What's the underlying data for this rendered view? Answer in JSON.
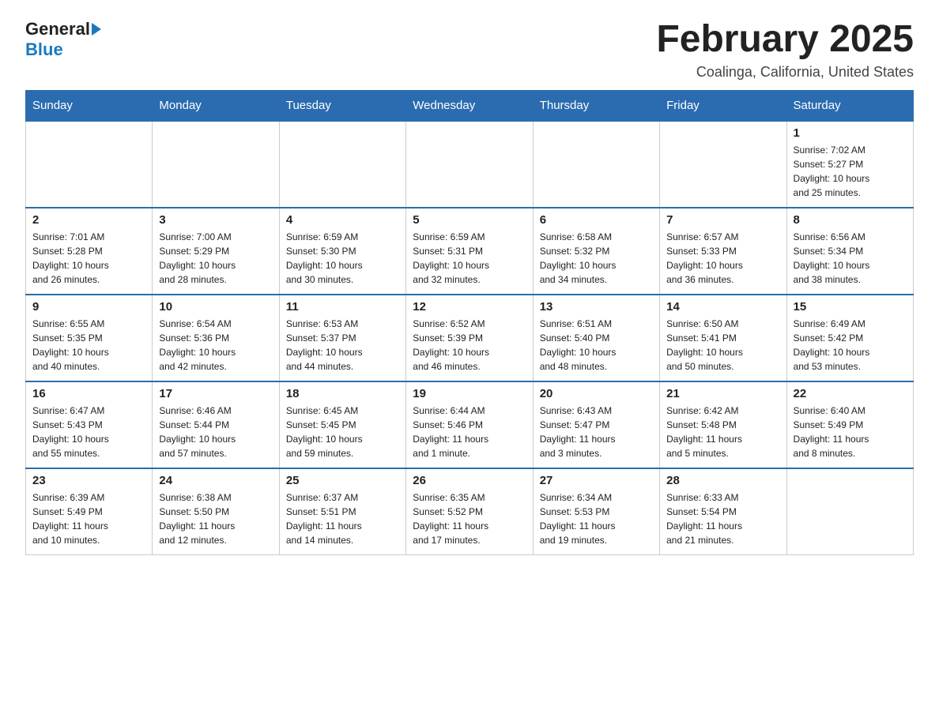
{
  "header": {
    "month_title": "February 2025",
    "location": "Coalinga, California, United States",
    "logo_general": "General",
    "logo_blue": "Blue"
  },
  "weekdays": [
    "Sunday",
    "Monday",
    "Tuesday",
    "Wednesday",
    "Thursday",
    "Friday",
    "Saturday"
  ],
  "weeks": [
    [
      {
        "day": "",
        "info": ""
      },
      {
        "day": "",
        "info": ""
      },
      {
        "day": "",
        "info": ""
      },
      {
        "day": "",
        "info": ""
      },
      {
        "day": "",
        "info": ""
      },
      {
        "day": "",
        "info": ""
      },
      {
        "day": "1",
        "info": "Sunrise: 7:02 AM\nSunset: 5:27 PM\nDaylight: 10 hours\nand 25 minutes."
      }
    ],
    [
      {
        "day": "2",
        "info": "Sunrise: 7:01 AM\nSunset: 5:28 PM\nDaylight: 10 hours\nand 26 minutes."
      },
      {
        "day": "3",
        "info": "Sunrise: 7:00 AM\nSunset: 5:29 PM\nDaylight: 10 hours\nand 28 minutes."
      },
      {
        "day": "4",
        "info": "Sunrise: 6:59 AM\nSunset: 5:30 PM\nDaylight: 10 hours\nand 30 minutes."
      },
      {
        "day": "5",
        "info": "Sunrise: 6:59 AM\nSunset: 5:31 PM\nDaylight: 10 hours\nand 32 minutes."
      },
      {
        "day": "6",
        "info": "Sunrise: 6:58 AM\nSunset: 5:32 PM\nDaylight: 10 hours\nand 34 minutes."
      },
      {
        "day": "7",
        "info": "Sunrise: 6:57 AM\nSunset: 5:33 PM\nDaylight: 10 hours\nand 36 minutes."
      },
      {
        "day": "8",
        "info": "Sunrise: 6:56 AM\nSunset: 5:34 PM\nDaylight: 10 hours\nand 38 minutes."
      }
    ],
    [
      {
        "day": "9",
        "info": "Sunrise: 6:55 AM\nSunset: 5:35 PM\nDaylight: 10 hours\nand 40 minutes."
      },
      {
        "day": "10",
        "info": "Sunrise: 6:54 AM\nSunset: 5:36 PM\nDaylight: 10 hours\nand 42 minutes."
      },
      {
        "day": "11",
        "info": "Sunrise: 6:53 AM\nSunset: 5:37 PM\nDaylight: 10 hours\nand 44 minutes."
      },
      {
        "day": "12",
        "info": "Sunrise: 6:52 AM\nSunset: 5:39 PM\nDaylight: 10 hours\nand 46 minutes."
      },
      {
        "day": "13",
        "info": "Sunrise: 6:51 AM\nSunset: 5:40 PM\nDaylight: 10 hours\nand 48 minutes."
      },
      {
        "day": "14",
        "info": "Sunrise: 6:50 AM\nSunset: 5:41 PM\nDaylight: 10 hours\nand 50 minutes."
      },
      {
        "day": "15",
        "info": "Sunrise: 6:49 AM\nSunset: 5:42 PM\nDaylight: 10 hours\nand 53 minutes."
      }
    ],
    [
      {
        "day": "16",
        "info": "Sunrise: 6:47 AM\nSunset: 5:43 PM\nDaylight: 10 hours\nand 55 minutes."
      },
      {
        "day": "17",
        "info": "Sunrise: 6:46 AM\nSunset: 5:44 PM\nDaylight: 10 hours\nand 57 minutes."
      },
      {
        "day": "18",
        "info": "Sunrise: 6:45 AM\nSunset: 5:45 PM\nDaylight: 10 hours\nand 59 minutes."
      },
      {
        "day": "19",
        "info": "Sunrise: 6:44 AM\nSunset: 5:46 PM\nDaylight: 11 hours\nand 1 minute."
      },
      {
        "day": "20",
        "info": "Sunrise: 6:43 AM\nSunset: 5:47 PM\nDaylight: 11 hours\nand 3 minutes."
      },
      {
        "day": "21",
        "info": "Sunrise: 6:42 AM\nSunset: 5:48 PM\nDaylight: 11 hours\nand 5 minutes."
      },
      {
        "day": "22",
        "info": "Sunrise: 6:40 AM\nSunset: 5:49 PM\nDaylight: 11 hours\nand 8 minutes."
      }
    ],
    [
      {
        "day": "23",
        "info": "Sunrise: 6:39 AM\nSunset: 5:49 PM\nDaylight: 11 hours\nand 10 minutes."
      },
      {
        "day": "24",
        "info": "Sunrise: 6:38 AM\nSunset: 5:50 PM\nDaylight: 11 hours\nand 12 minutes."
      },
      {
        "day": "25",
        "info": "Sunrise: 6:37 AM\nSunset: 5:51 PM\nDaylight: 11 hours\nand 14 minutes."
      },
      {
        "day": "26",
        "info": "Sunrise: 6:35 AM\nSunset: 5:52 PM\nDaylight: 11 hours\nand 17 minutes."
      },
      {
        "day": "27",
        "info": "Sunrise: 6:34 AM\nSunset: 5:53 PM\nDaylight: 11 hours\nand 19 minutes."
      },
      {
        "day": "28",
        "info": "Sunrise: 6:33 AM\nSunset: 5:54 PM\nDaylight: 11 hours\nand 21 minutes."
      },
      {
        "day": "",
        "info": ""
      }
    ]
  ]
}
